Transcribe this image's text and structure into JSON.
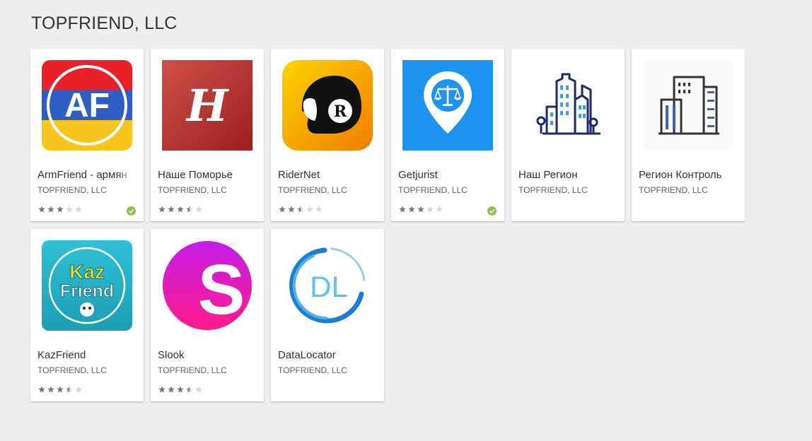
{
  "developer": {
    "name": "TOPFRIEND, LLC"
  },
  "colors": {
    "star_filled": "#777777",
    "star_empty": "#d6d6d6",
    "badge": "#8bc34a",
    "background": "#eeeeee"
  },
  "apps": [
    {
      "name": "ArmFriend - армян",
      "developer": "TOPFRIEND, LLC",
      "rating": 3.0,
      "editors_choice_icon": "check-circle-icon",
      "icon": "armfriend-logo",
      "logo_text": "AF"
    },
    {
      "name": "Наше Поморье",
      "developer": "TOPFRIEND, LLC",
      "rating": 3.5,
      "icon": "pomorye-logo",
      "logo_text": "H"
    },
    {
      "name": "RiderNet",
      "developer": "TOPFRIEND, LLC",
      "rating": 2.5,
      "icon": "helmet-logo",
      "logo_text": "R"
    },
    {
      "name": "Getjurist",
      "developer": "TOPFRIEND, LLC",
      "rating": 3.0,
      "editors_choice_icon": "check-circle-icon",
      "icon": "scales-pin-logo"
    },
    {
      "name": "Наш Регион",
      "developer": "TOPFRIEND, LLC",
      "icon": "city-buildings-logo"
    },
    {
      "name": "Регион Контроль",
      "developer": "TOPFRIEND, LLC",
      "icon": "office-buildings-logo"
    },
    {
      "name": "KazFriend",
      "developer": "TOPFRIEND, LLC",
      "rating": 3.5,
      "icon": "kazfriend-logo",
      "logo_text": [
        "Kaz",
        "Friend"
      ]
    },
    {
      "name": "Slook",
      "developer": "TOPFRIEND, LLC",
      "rating": 3.5,
      "icon": "slook-logo",
      "logo_text": "S"
    },
    {
      "name": "DataLocator",
      "developer": "TOPFRIEND, LLC",
      "icon": "datalocator-logo",
      "logo_text": "DL"
    }
  ]
}
